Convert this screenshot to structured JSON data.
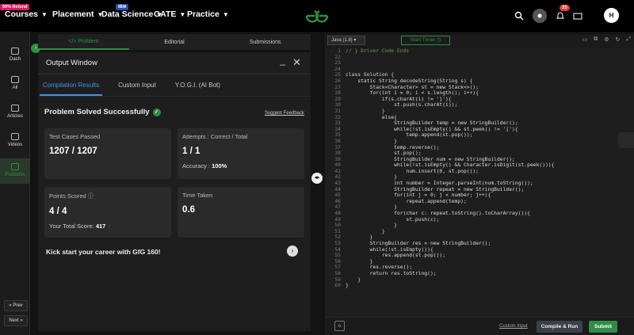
{
  "nav": {
    "badge_refund": "90% Refund",
    "badge_ibm": "IBM",
    "courses": "Courses",
    "placement": "Placement",
    "data_science": "Data Science",
    "gate": "GATE",
    "practice": "Practice",
    "notifications_count": "25",
    "avatar_initial": "H"
  },
  "sidebar": {
    "dash": "Dash",
    "all": "All",
    "articles": "Articles",
    "videos": "Videos",
    "problems": "Problems",
    "prev": "« Prev",
    "next": "Next »"
  },
  "problem_tabs": [
    "</> Problem",
    "Editorial",
    "Submissions"
  ],
  "output": {
    "title": "Output Window",
    "subtabs": [
      "Compilation Results",
      "Custom Input",
      "Y.O.G.I. (AI Bot)"
    ],
    "status": "Problem Solved Successfully",
    "suggest": "Suggest Feedback",
    "test_cases_label": "Test Cases Passed",
    "test_cases_value": "1207 / 1207",
    "attempts_label": "Attempts : Correct / Total",
    "attempts_value": "1 / 1",
    "accuracy_label": "Accuracy :",
    "accuracy_value": "100%",
    "points_label": "Points Scored",
    "points_value": "4 / 4",
    "total_score_label": "Your Total Score:",
    "total_score_value": "417",
    "time_label": "Time Taken",
    "time_value": "0.6",
    "kick": "Kick start your career with GfG 160!"
  },
  "editor": {
    "language": "Java (1.8)",
    "timer": "Start Timer",
    "custom_input": "Custom Input",
    "compile": "Compile & Run",
    "submit": "Submit",
    "line_numbers": [
      "1",
      "22",
      "23",
      "24",
      "25",
      "26",
      "27",
      "28",
      "29",
      "30",
      "31",
      "32",
      "33",
      "34",
      "35",
      "36",
      "37",
      "38",
      "39",
      "40",
      "41",
      "42",
      "43",
      "44",
      "45",
      "46",
      "47",
      "48",
      "49",
      "50",
      "51",
      "52",
      "53",
      "54",
      "55",
      "56",
      "57",
      "58",
      "59",
      "60"
    ],
    "lines": [
      "// } Driver Code Ends",
      "",
      "",
      "",
      "class Solution {",
      "    static String decodeString(String s) {",
      "        Stack<Character> st = new Stack<>();",
      "        for(int i = 0; i < s.length(); i++){",
      "            if(s.charAt(i) != ']'){",
      "                st.push(s.charAt(i));",
      "            }",
      "            else{",
      "                StringBuilder temp = new StringBuilder();",
      "                while(!st.isEmpty() && st.peek() != '['){",
      "                    temp.append(st.pop());",
      "                }",
      "                temp.reverse();",
      "                st.pop();",
      "                StringBuilder num = new StringBuilder();",
      "                while(!st.isEmpty() && Character.isDigit(st.peek())){",
      "                    num.insert(0, st.pop());",
      "                }",
      "                int number = Integer.parseInt(num.toString());",
      "                StringBuilder repeat = new StringBuilder();",
      "                for(int j = 0; j < number; j++){",
      "                    repeat.append(temp);",
      "                }",
      "                for(char c: repeat.toString().toCharArray()){",
      "                    st.push(c);",
      "                }",
      "            }",
      "        }",
      "        StringBuilder res = new StringBuilder();",
      "        while(!st.isEmpty()){",
      "            res.append(st.pop());",
      "        }",
      "        res.reverse();",
      "        return res.toString();",
      "    }",
      "}"
    ]
  }
}
